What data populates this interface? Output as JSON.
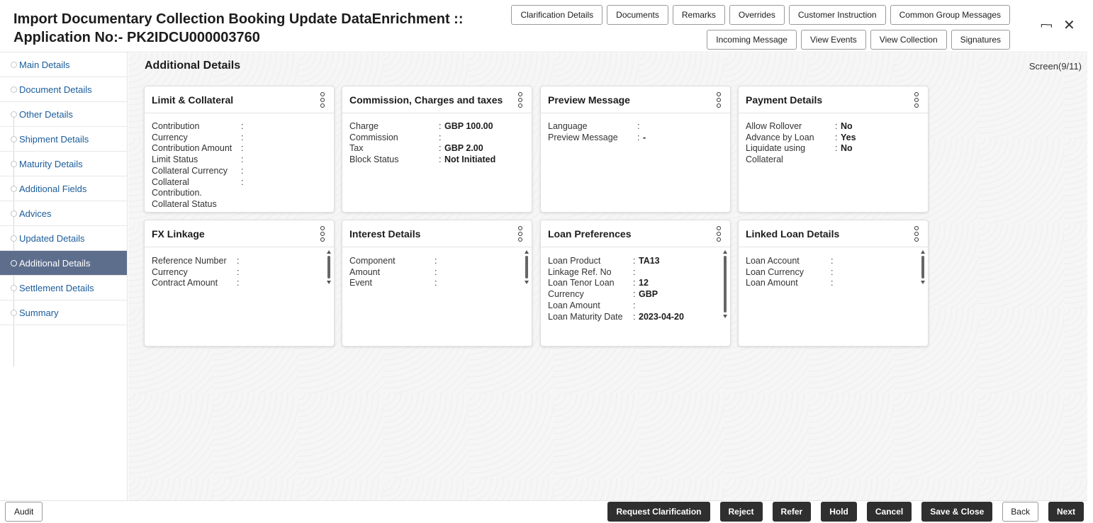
{
  "header": {
    "title_line1": "Import Documentary Collection Booking Update DataEnrichment ::",
    "title_line2": "Application No:- PK2IDCU000003760",
    "buttons_row1": [
      "Clarification Details",
      "Documents",
      "Remarks",
      "Overrides",
      "Customer Instruction",
      "Common Group Messages"
    ],
    "buttons_row2": [
      "Incoming Message",
      "View Events",
      "View Collection",
      "Signatures"
    ],
    "collapse_icon": "⌐¬",
    "close_icon": "✕"
  },
  "sidebar": {
    "items": [
      {
        "label": "Main Details",
        "active": false
      },
      {
        "label": "Document Details",
        "active": false
      },
      {
        "label": "Other Details",
        "active": false
      },
      {
        "label": "Shipment Details",
        "active": false
      },
      {
        "label": "Maturity Details",
        "active": false
      },
      {
        "label": "Additional Fields",
        "active": false
      },
      {
        "label": "Advices",
        "active": false
      },
      {
        "label": "Updated Details",
        "active": false
      },
      {
        "label": "Additional Details",
        "active": true
      },
      {
        "label": "Settlement Details",
        "active": false
      },
      {
        "label": "Summary",
        "active": false
      }
    ]
  },
  "main": {
    "section_title": "Additional Details",
    "screen_indicator": "Screen(9/11)",
    "cards": [
      {
        "title": "Limit & Collateral",
        "label_width": 126,
        "rows": [
          {
            "label": "Contribution",
            "value": ""
          },
          {
            "label": "Currency",
            "value": ""
          },
          {
            "label": "Contribution Amount",
            "value": ""
          },
          {
            "label": "Limit Status",
            "value": ""
          },
          {
            "label": "Collateral Currency",
            "value": ""
          },
          {
            "label": "Collateral",
            "value": ""
          },
          {
            "label": "Contribution.",
            "value": "",
            "no_colon": true
          },
          {
            "label": "Collateral Status",
            "value": "",
            "no_colon": true
          }
        ]
      },
      {
        "title": "Commission, Charges and taxes",
        "label_width": 126,
        "rows": [
          {
            "label": "Charge",
            "value": "GBP  100.00"
          },
          {
            "label": "Commission",
            "value": ""
          },
          {
            "label": "Tax",
            "value": "GBP  2.00"
          },
          {
            "label": "Block Status",
            "value": "Not Initiated"
          }
        ]
      },
      {
        "title": "Preview Message",
        "label_width": 126,
        "rows": [
          {
            "label": "Language",
            "value": ""
          },
          {
            "label": "Preview Message",
            "value": "-"
          }
        ]
      },
      {
        "title": "Payment Details",
        "label_width": 126,
        "rows": [
          {
            "label": "Allow Rollover",
            "value": "No"
          },
          {
            "label": "Advance by Loan",
            "value": "Yes"
          },
          {
            "label": "Liquidate using",
            "value": "No"
          },
          {
            "label": "Collateral",
            "value": "",
            "no_colon": true
          }
        ]
      },
      {
        "title": "FX Linkage",
        "label_width": 120,
        "scroll": true,
        "rows": [
          {
            "label": "Reference Number",
            "value": ""
          },
          {
            "label": "Currency",
            "value": ""
          },
          {
            "label": "Contract Amount",
            "value": ""
          }
        ]
      },
      {
        "title": "Interest Details",
        "label_width": 120,
        "scroll": true,
        "rows": [
          {
            "label": "Component",
            "value": ""
          },
          {
            "label": "Amount",
            "value": ""
          },
          {
            "label": "Event",
            "value": ""
          }
        ]
      },
      {
        "title": "Loan Preferences",
        "label_width": 120,
        "scroll": true,
        "tall_scroll": true,
        "rows": [
          {
            "label": "Loan Product",
            "value": "TA13"
          },
          {
            "label": "Linkage Ref. No",
            "value": ""
          },
          {
            "label": "Loan Tenor Loan",
            "value": "12"
          },
          {
            "label": "Currency",
            "value": "GBP"
          },
          {
            "label": "Loan Amount",
            "value": ""
          },
          {
            "label": "Loan Maturity Date",
            "value": "2023-04-20"
          }
        ]
      },
      {
        "title": "Linked Loan Details",
        "label_width": 120,
        "scroll": true,
        "rows": [
          {
            "label": "Loan Account",
            "value": ""
          },
          {
            "label": "Loan Currency",
            "value": ""
          },
          {
            "label": "Loan Amount",
            "value": ""
          }
        ]
      }
    ]
  },
  "footer": {
    "audit_label": "Audit",
    "buttons": [
      {
        "label": "Request Clarification",
        "style": "dark"
      },
      {
        "label": "Reject",
        "style": "dark"
      },
      {
        "label": "Refer",
        "style": "dark"
      },
      {
        "label": "Hold",
        "style": "dark"
      },
      {
        "label": "Cancel",
        "style": "dark"
      },
      {
        "label": "Save & Close",
        "style": "dark"
      },
      {
        "label": "Back",
        "style": "light"
      },
      {
        "label": "Next",
        "style": "dark"
      }
    ]
  }
}
